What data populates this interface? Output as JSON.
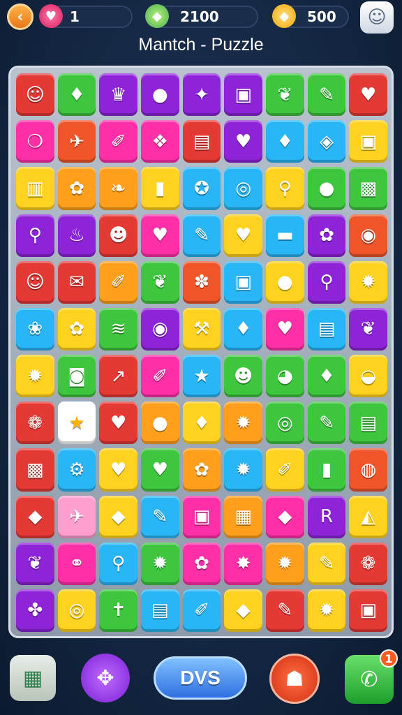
{
  "header": {
    "back_icon": "chevron-left-icon",
    "lives": "1",
    "lives_icon": "strawberry-icon",
    "score": "2100",
    "score_icon": "green-gem-icon",
    "coins": "500",
    "coins_icon": "gold-gem-icon",
    "profile_icon": "smiley-face-icon"
  },
  "title": "Mantch - Puzzle",
  "board": {
    "rows": [
      [
        [
          "#e53935",
          "☺"
        ],
        [
          "#3ec63e",
          "♦"
        ],
        [
          "#8e24d8",
          "♛"
        ],
        [
          "#8e24d8",
          "●"
        ],
        [
          "#8e24d8",
          "✦"
        ],
        [
          "#8e24d8",
          "▣"
        ],
        [
          "#3ec63e",
          "❦"
        ],
        [
          "#3ec63e",
          "✎"
        ],
        [
          "#e53935",
          "♥"
        ]
      ],
      [
        [
          "#ff2fa8",
          "❍"
        ],
        [
          "#f0552a",
          "✈"
        ],
        [
          "#ff2fa8",
          "✐"
        ],
        [
          "#ff2fa8",
          "❖"
        ],
        [
          "#e53935",
          "▤"
        ],
        [
          "#8e24d8",
          "♥"
        ],
        [
          "#29b6f6",
          "♦"
        ],
        [
          "#29b6f6",
          "◈"
        ],
        [
          "#ffd21f",
          "▣"
        ]
      ],
      [
        [
          "#ffd21f",
          "▥"
        ],
        [
          "#ff9f1c",
          "✿"
        ],
        [
          "#ff9f1c",
          "❧"
        ],
        [
          "#ffd21f",
          "▮"
        ],
        [
          "#29b6f6",
          "✪"
        ],
        [
          "#29b6f6",
          "◎"
        ],
        [
          "#ffd21f",
          "⚲"
        ],
        [
          "#3ec63e",
          "●"
        ],
        [
          "#3ec63e",
          "▩"
        ]
      ],
      [
        [
          "#8e24d8",
          "⚲"
        ],
        [
          "#8e24d8",
          "♨"
        ],
        [
          "#e53935",
          "☻"
        ],
        [
          "#ff2fa8",
          "♥"
        ],
        [
          "#29b6f6",
          "✎"
        ],
        [
          "#ffd21f",
          "♥"
        ],
        [
          "#29b6f6",
          "▬"
        ],
        [
          "#8e24d8",
          "✿"
        ],
        [
          "#f0552a",
          "◉"
        ]
      ],
      [
        [
          "#e53935",
          "☺"
        ],
        [
          "#e53935",
          "✉"
        ],
        [
          "#ff9f1c",
          "✐"
        ],
        [
          "#3ec63e",
          "❦"
        ],
        [
          "#f0552a",
          "✽"
        ],
        [
          "#29b6f6",
          "▣"
        ],
        [
          "#ffd21f",
          "●"
        ],
        [
          "#8e24d8",
          "⚲"
        ],
        [
          "#ffd21f",
          "✹"
        ]
      ],
      [
        [
          "#29b6f6",
          "❀"
        ],
        [
          "#ffd21f",
          "✿"
        ],
        [
          "#3ec63e",
          "≋"
        ],
        [
          "#8e24d8",
          "◉"
        ],
        [
          "#ffd21f",
          "⚒"
        ],
        [
          "#29b6f6",
          "♦"
        ],
        [
          "#ff2fa8",
          "♥"
        ],
        [
          "#29b6f6",
          "▤"
        ],
        [
          "#8e24d8",
          "❦"
        ]
      ],
      [
        [
          "#ffd21f",
          "✹"
        ],
        [
          "#3ec63e",
          "◙"
        ],
        [
          "#e53935",
          "↗"
        ],
        [
          "#ff2fa8",
          "✐"
        ],
        [
          "#29b6f6",
          "★"
        ],
        [
          "#3ec63e",
          "☻"
        ],
        [
          "#3ec63e",
          "◕"
        ],
        [
          "#3ec63e",
          "♦"
        ],
        [
          "#ffd21f",
          "◒"
        ]
      ],
      [
        [
          "#e53935",
          "❁"
        ],
        [
          "#ffffff",
          "★"
        ],
        [
          "#e53935",
          "♥"
        ],
        [
          "#ff9f1c",
          "●"
        ],
        [
          "#ffd21f",
          "♦"
        ],
        [
          "#ff9f1c",
          "✹"
        ],
        [
          "#3ec63e",
          "◎"
        ],
        [
          "#3ec63e",
          "✎"
        ],
        [
          "#3ec63e",
          "▤"
        ]
      ],
      [
        [
          "#e53935",
          "▩"
        ],
        [
          "#29b6f6",
          "⚙"
        ],
        [
          "#ffd21f",
          "♥"
        ],
        [
          "#3ec63e",
          "♥"
        ],
        [
          "#ff9f1c",
          "✿"
        ],
        [
          "#29b6f6",
          "✹"
        ],
        [
          "#ffd21f",
          "✐"
        ],
        [
          "#3ec63e",
          "▮"
        ],
        [
          "#f0552a",
          "◍"
        ]
      ],
      [
        [
          "#e53935",
          "◆"
        ],
        [
          "#ff9fd0",
          "✈"
        ],
        [
          "#ffd21f",
          "◆"
        ],
        [
          "#29b6f6",
          "✎"
        ],
        [
          "#ff2fa8",
          "▣"
        ],
        [
          "#ff9f1c",
          "▦"
        ],
        [
          "#ff2fa8",
          "◆"
        ],
        [
          "#8e24d8",
          "R"
        ],
        [
          "#ffd21f",
          "◭"
        ]
      ],
      [
        [
          "#8e24d8",
          "❦"
        ],
        [
          "#ff2fa8",
          "⚭"
        ],
        [
          "#29b6f6",
          "⚲"
        ],
        [
          "#3ec63e",
          "✹"
        ],
        [
          "#ff2fa8",
          "✿"
        ],
        [
          "#ff2fa8",
          "✸"
        ],
        [
          "#ff9f1c",
          "✹"
        ],
        [
          "#ffd21f",
          "✎"
        ],
        [
          "#e53935",
          "❁"
        ]
      ],
      [
        [
          "#8e24d8",
          "✤"
        ],
        [
          "#ffd21f",
          "◎"
        ],
        [
          "#3ec63e",
          "✝"
        ],
        [
          "#29b6f6",
          "▤"
        ],
        [
          "#29b6f6",
          "✐"
        ],
        [
          "#ffd21f",
          "◆"
        ],
        [
          "#e53935",
          "✎"
        ],
        [
          "#ffd21f",
          "✹"
        ],
        [
          "#e53935",
          "▣"
        ]
      ]
    ]
  },
  "footer": {
    "map_icon": "map-icon",
    "gamepad_icon": "gamepad-icon",
    "center_button_label": "DVS",
    "profile_icon": "person-icon",
    "chat_icon": "chat-bubble-icon",
    "chat_badge": "1"
  }
}
